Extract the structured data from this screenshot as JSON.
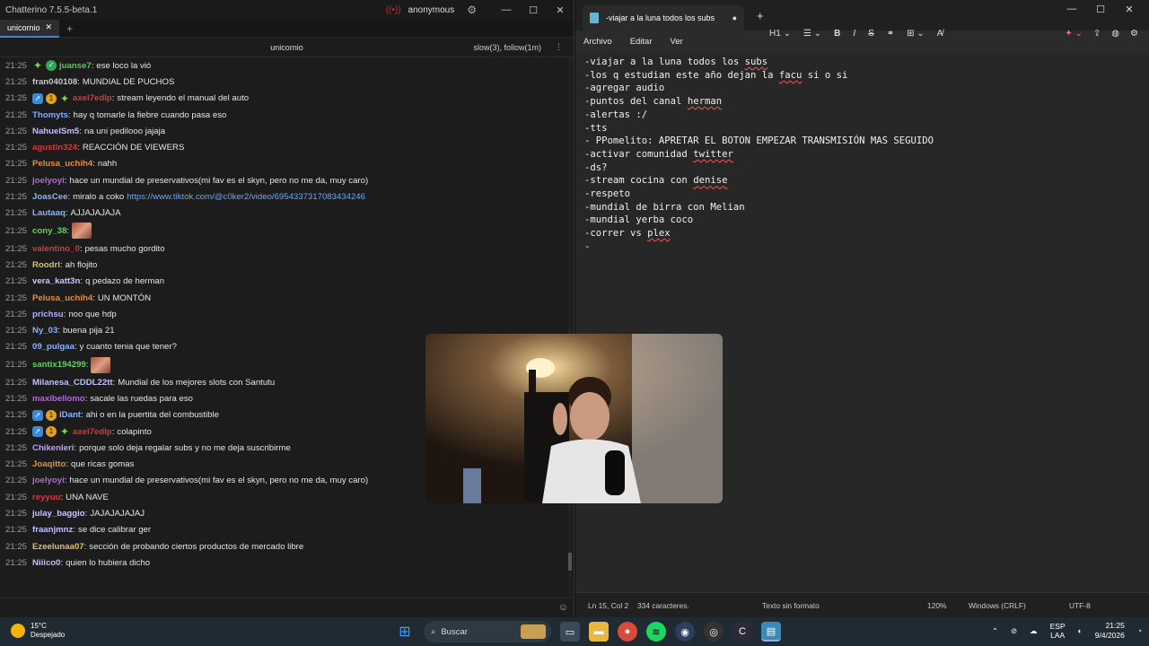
{
  "chatterino": {
    "window_title": "Chatterino 7.5.5-beta.1",
    "account": "anonymous",
    "tab": "unicornio",
    "channel": "unicornio",
    "modes": "slow(3), follow(1m)",
    "messages": [
      {
        "ts": "21:25",
        "badges": [
          "sparkle",
          "verified"
        ],
        "user": "juanse7",
        "color": "#4fd14f",
        "text": "ese loco la vió"
      },
      {
        "ts": "21:25",
        "badges": [],
        "user": "fran040108",
        "color": "#c8c8c8",
        "text": "MUNDIAL DE PUCHOS"
      },
      {
        "ts": "21:25",
        "badges": [
          "staff",
          "one",
          "sparkle"
        ],
        "user": "axel7edlp",
        "color": "#d23b3b",
        "text": "stream leyendo el manual del auto"
      },
      {
        "ts": "21:25",
        "badges": [],
        "user": "Thomyts",
        "color": "#8aa8ff",
        "text": "hay q tomarle la fiebre cuando pasa eso"
      },
      {
        "ts": "21:25",
        "badges": [],
        "user": "NahuelSm5",
        "color": "#c0c0ff",
        "text": "na uni pedilooo jajaja"
      },
      {
        "ts": "21:25",
        "badges": [],
        "user": "agustin324",
        "color": "#d23b3b",
        "text": "REACCIÓN DE VIEWERS"
      },
      {
        "ts": "21:25",
        "badges": [],
        "user": "Pelusa_uchih4",
        "color": "#e09040",
        "text": "nahh"
      },
      {
        "ts": "21:25",
        "badges": [],
        "user": "joelyoyi",
        "color": "#b06ad8",
        "text": "hace un mundial de preservativos(mi fav es el skyn, pero no me da, muy caro)"
      },
      {
        "ts": "21:25",
        "badges": [],
        "user": "JoasCee",
        "color": "#8ab4ff",
        "text": "miralo a coko ",
        "link": "https://www.tiktok.com/@c0ker2/video/6954337317083434246"
      },
      {
        "ts": "21:25",
        "badges": [],
        "user": "Lautaaq",
        "color": "#8ab4ff",
        "text": "AJJAJAJAJA"
      },
      {
        "ts": "21:25",
        "badges": [],
        "user": "cony_38",
        "color": "#5fd45f",
        "text": "",
        "emote": true
      },
      {
        "ts": "21:25",
        "badges": [],
        "user": "valentino_0",
        "color": "#d23b3b",
        "text": "pesas mucho gordito"
      },
      {
        "ts": "21:25",
        "badges": [],
        "user": "Roodrl",
        "color": "#e0c060",
        "text": "ah flojito"
      },
      {
        "ts": "21:25",
        "badges": [],
        "user": "vera_katt3n",
        "color": "#c8c8ff",
        "text": "q pedazo de herman"
      },
      {
        "ts": "21:25",
        "badges": [],
        "user": "Pelusa_uchih4",
        "color": "#e09040",
        "text": "UN MONTÓN"
      },
      {
        "ts": "21:25",
        "badges": [],
        "user": "prichsu",
        "color": "#b0b0ff",
        "text": "noo que hdp"
      },
      {
        "ts": "21:25",
        "badges": [],
        "user": "Ny_03",
        "color": "#8ab4ff",
        "text": "buena pija 21"
      },
      {
        "ts": "21:25",
        "badges": [],
        "user": "09_pulgaa",
        "color": "#8ab4ff",
        "text": "y cuanto tenia que tener?"
      },
      {
        "ts": "21:25",
        "badges": [],
        "user": "santix194299",
        "color": "#5fd45f",
        "text": "",
        "emote": true
      },
      {
        "ts": "21:25",
        "badges": [],
        "user": "Milanesa_CDDL22tt",
        "color": "#c0c0ff",
        "text": "Mundial de los mejores slots con Santutu"
      },
      {
        "ts": "21:25",
        "badges": [],
        "user": "maxibellomo",
        "color": "#b06ad8",
        "text": "sacale las ruedas para eso"
      },
      {
        "ts": "21:25",
        "badges": [
          "staff",
          "one"
        ],
        "user": "iDant",
        "color": "#8ab4ff",
        "text": "ahi o en la puertita del combustible"
      },
      {
        "ts": "21:25",
        "badges": [
          "staff",
          "one",
          "sparkle"
        ],
        "user": "axel7edlp",
        "color": "#d23b3b",
        "text": "colapinto"
      },
      {
        "ts": "21:25",
        "badges": [],
        "user": "Chikenleri",
        "color": "#c0a0ff",
        "text": "porque solo deja regalar subs y no me deja suscribirme"
      },
      {
        "ts": "21:25",
        "badges": [],
        "user": "Joaqitto",
        "color": "#e09040",
        "text": "que ricas gomas"
      },
      {
        "ts": "21:25",
        "badges": [],
        "user": "joelyoyi",
        "color": "#b06ad8",
        "text": "hace un mundial de preservativos(mi fav es el skyn, pero no me da, muy caro)"
      },
      {
        "ts": "21:25",
        "badges": [],
        "user": "reyyuu",
        "color": "#d23b3b",
        "text": "UNA NAVE"
      },
      {
        "ts": "21:25",
        "badges": [],
        "user": "julay_baggio",
        "color": "#c8c8ff",
        "text": "JAJAJAJAJAJ"
      },
      {
        "ts": "21:25",
        "badges": [],
        "user": "fraanjmnz",
        "color": "#c0c0ff",
        "text": "se dice calibrar ger"
      },
      {
        "ts": "21:25",
        "badges": [],
        "user": "Ezeelunaa07",
        "color": "#e0c060",
        "text": "sección de probando ciertos productos de mercado libre"
      },
      {
        "ts": "21:25",
        "badges": [],
        "user": "Niiico0",
        "color": "#c0c0ff",
        "text": "quien lo hubiera dicho"
      }
    ]
  },
  "notepad": {
    "tab_title": "-viajar a la luna todos los subs",
    "menu": [
      "Archivo",
      "Editar",
      "Ver"
    ],
    "heading_select": "H1",
    "lines": [
      "-viajar a la luna todos los subs",
      "-los q estudian este año dejan la facu si o si",
      "-agregar audio",
      "-puntos del canal herman",
      "-alertas :/",
      "-tts",
      "- PPomelito: APRETAR EL BOTON EMPEZAR TRANSMISIÓN MAS SEGUIDO",
      "-activar comunidad twitter",
      "-ds?",
      "-stream cocina con denise",
      "-respeto",
      "-mundial de birra con Melian",
      "-mundial yerba coco",
      "-correr vs plex",
      "-"
    ],
    "status": {
      "position": "Ln 15, Col 2",
      "chars": "334 caracteres.",
      "format": "Texto sin formato",
      "zoom": "120%",
      "eol": "Windows (CRLF)",
      "encoding": "UTF-8"
    }
  },
  "taskbar": {
    "temp": "15°C",
    "weather": "Despejado",
    "search_placeholder": "Buscar",
    "lang1": "ESP",
    "lang2": "LAA",
    "time": "21:25",
    "date": "9/4/2026"
  }
}
